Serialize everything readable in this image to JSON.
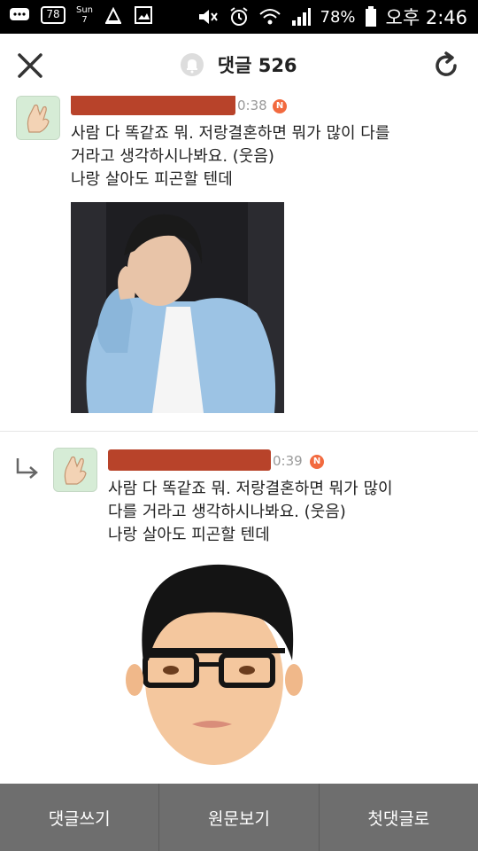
{
  "status_bar": {
    "icons": [
      "message-icon",
      "calendar-icon",
      "sun-icon",
      "recycle-icon",
      "gallery-icon",
      "mute-icon",
      "alarm-icon",
      "wifi-icon",
      "signal-icon",
      "battery-icon"
    ],
    "calendar_badge": "78",
    "sun_label": "Sun",
    "sun_day": "7",
    "battery": "78%",
    "time": "오후 2:46"
  },
  "app_bar": {
    "title": "댓글 526"
  },
  "comments": [
    {
      "time": "0:38",
      "badge": "N",
      "lines": [
        "사람 다 똑같죠 뭐. 저랑결혼하면 뭐가 많이 다를",
        "거라고 생각하시나봐요. (웃음)",
        "나랑 살아도 피곤할 텐데"
      ],
      "image": "photo-man-blue-jacket"
    },
    {
      "time": "0:39",
      "badge": "N",
      "lines": [
        "사람 다 똑같죠 뭐. 저랑결혼하면 뭐가 많이",
        "다를 거라고 생각하시나봐요. (웃음)",
        "나랑 살아도 피곤할 텐데"
      ],
      "image": "illustration-man-glasses",
      "is_reply": true
    }
  ],
  "bottom_bar": {
    "write": "댓글쓰기",
    "original": "원문보기",
    "first": "첫댓글로"
  },
  "colors": {
    "status_bg": "#000000",
    "bottom_bg": "#6e6e6e",
    "badge": "#f26a3f",
    "redaction": "#b8432a"
  }
}
